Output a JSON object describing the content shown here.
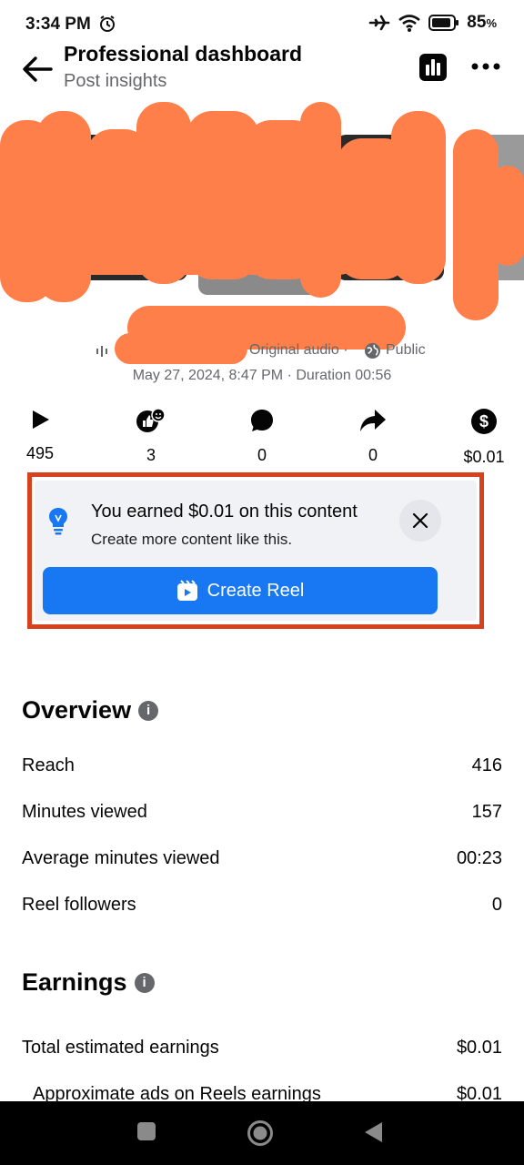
{
  "status_bar": {
    "time": "3:34 PM",
    "battery": "85",
    "icons": [
      "alarm-icon",
      "airplane-icon",
      "wifi-icon",
      "battery-icon"
    ]
  },
  "header": {
    "title": "Professional dashboard",
    "subtitle": "Post insights"
  },
  "post_meta": {
    "audio": "Original audio",
    "separator": "·",
    "privacy": "Public",
    "date_line": "May 27, 2024, 8:47 PM · Duration 00:56"
  },
  "stats": [
    {
      "icon": "play-icon",
      "value": "495"
    },
    {
      "icon": "reactions-icon",
      "value": "3"
    },
    {
      "icon": "comment-icon",
      "value": "0"
    },
    {
      "icon": "share-icon",
      "value": "0"
    },
    {
      "icon": "dollar-icon",
      "value": "$0.01"
    }
  ],
  "earnings_card": {
    "title": "You earned $0.01 on this content",
    "text": "Create more content like this.",
    "button": "Create Reel"
  },
  "overview": {
    "title": "Overview",
    "rows": [
      {
        "label": "Reach",
        "value": "416"
      },
      {
        "label": "Minutes viewed",
        "value": "157"
      },
      {
        "label": "Average minutes viewed",
        "value": "00:23"
      },
      {
        "label": "Reel followers",
        "value": "0"
      }
    ]
  },
  "earnings": {
    "title": "Earnings",
    "rows": [
      {
        "label": "Total estimated earnings",
        "value": "$0.01"
      },
      {
        "label": "Approximate ads on Reels earnings",
        "value": "$0.01"
      }
    ]
  },
  "colors": {
    "accent": "#1877f2",
    "highlight_border": "#d7411c",
    "redaction": "#ff7f4a",
    "card_bg": "#f0f2f5"
  }
}
